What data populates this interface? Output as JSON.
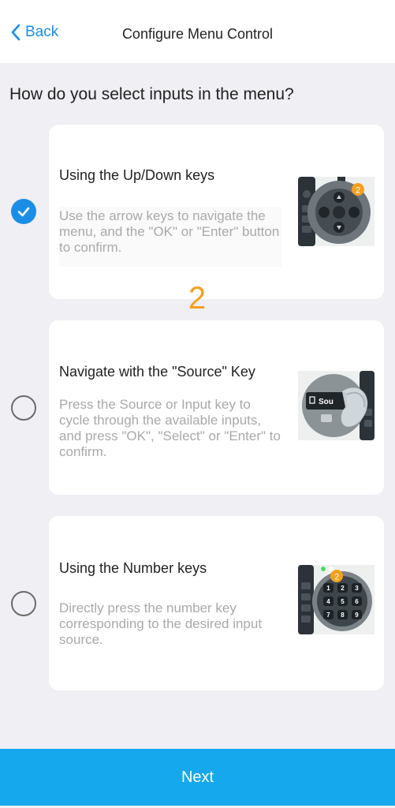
{
  "header": {
    "back_label": "Back",
    "title": "Configure Menu Control"
  },
  "question": "How do you select inputs in the menu?",
  "step_number": "2",
  "options": [
    {
      "title": "Using the Up/Down keys",
      "description": "Use the arrow keys to navigate the menu, and the \"OK\" or \"Enter\" button to confirm.",
      "selected": true,
      "image_icon": "remote-arrow-keys-icon",
      "badge": "2"
    },
    {
      "title": "Navigate with the \"Source\" Key",
      "description": "Press the Source or Input key to cycle through the available inputs, and press \"OK\", \"Select\" or \"Enter\" to confirm.",
      "selected": false,
      "image_icon": "remote-source-key-icon",
      "image_text": "Sou"
    },
    {
      "title": "Using the Number keys",
      "description": "Directly press the number key corresponding to the desired input source.",
      "selected": false,
      "image_icon": "remote-number-keys-icon",
      "badge": "2",
      "keys": [
        "1",
        "2",
        "3",
        "4",
        "5",
        "6",
        "7",
        "8",
        "9"
      ]
    }
  ],
  "footer": {
    "next_label": "Next"
  },
  "colors": {
    "accent": "#1a8ee6",
    "button": "#16a8ec",
    "step_number": "#f5a01e",
    "background": "#efeff4"
  }
}
